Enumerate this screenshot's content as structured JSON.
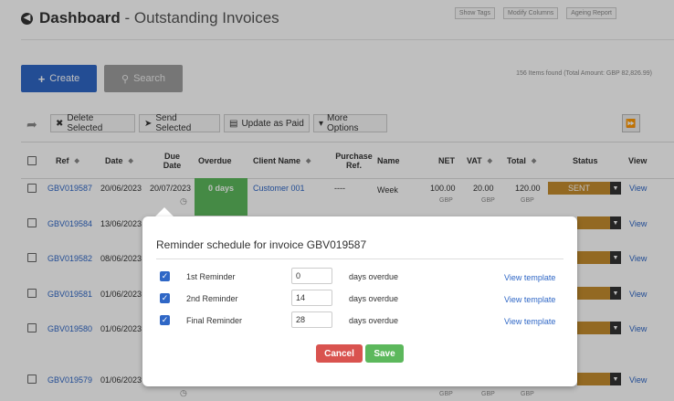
{
  "header": {
    "title": "Dashboard",
    "separator": " - ",
    "subtitle": "Outstanding Invoices",
    "links": [
      "Show Tags",
      "Modify Columns",
      "Ageing Report"
    ]
  },
  "actions": {
    "create_label": "Create",
    "search_label": "Search",
    "items_found": "156 Items found (Total Amount: GBP 82,826.99)"
  },
  "toolbar": {
    "delete_selected": "Delete Selected",
    "send_selected": "Send Selected",
    "update_as_paid": "Update as Paid",
    "more_options": "More Options"
  },
  "table": {
    "columns": {
      "ref": "Ref",
      "date": "Date",
      "due_date_line1": "Due",
      "due_date_line2": "Date",
      "overdue": "Overdue",
      "client_name": "Client Name",
      "purchase_ref_line1": "Purchase",
      "purchase_ref_line2": "Ref.",
      "name": "Name",
      "net": "NET",
      "vat": "VAT",
      "total": "Total",
      "status": "Status",
      "view": "View"
    },
    "rows": [
      {
        "ref": "GBV019587",
        "date": "20/06/2023",
        "due_date": "20/07/2023",
        "overdue": "0 days",
        "client": "Customer 001",
        "purchase_ref": "----",
        "name": "Week",
        "net": "100.00",
        "vat": "20.00",
        "total": "120.00",
        "currency": "GBP",
        "status": "SENT",
        "view": "View"
      },
      {
        "ref": "GBV019584",
        "date": "13/06/2023",
        "view": "View"
      },
      {
        "ref": "GBV019582",
        "date": "08/06/2023",
        "view": "View"
      },
      {
        "ref": "GBV019581",
        "date": "01/06/2023",
        "view": "View"
      },
      {
        "ref": "GBV019580",
        "date": "01/06/2023",
        "view": "View"
      },
      {
        "ref": "GBV019579",
        "date": "01/06/2023",
        "view": "View"
      }
    ],
    "partial_gbp": "GBP"
  },
  "modal": {
    "title": "Reminder schedule for invoice GBV019587",
    "reminders": [
      {
        "label": "1st Reminder",
        "value": "0",
        "suffix": "days overdue",
        "link": "View template"
      },
      {
        "label": "2nd Reminder",
        "value": "14",
        "suffix": "days overdue",
        "link": "View template"
      },
      {
        "label": "Final Reminder",
        "value": "28",
        "suffix": "days overdue",
        "link": "View template"
      }
    ],
    "cancel_label": "Cancel",
    "save_label": "Save"
  },
  "colors": {
    "primary": "#2f67c6",
    "status_sent": "#c58c2e",
    "success": "#5cb85c",
    "danger": "#d9534f"
  },
  "icons": [
    "back-arrow-icon",
    "plus-icon",
    "search-icon",
    "share-icon",
    "close-icon",
    "send-icon",
    "card-icon",
    "caret-down-icon",
    "fast-forward-icon",
    "sort-icon",
    "clock-icon",
    "check-icon"
  ]
}
